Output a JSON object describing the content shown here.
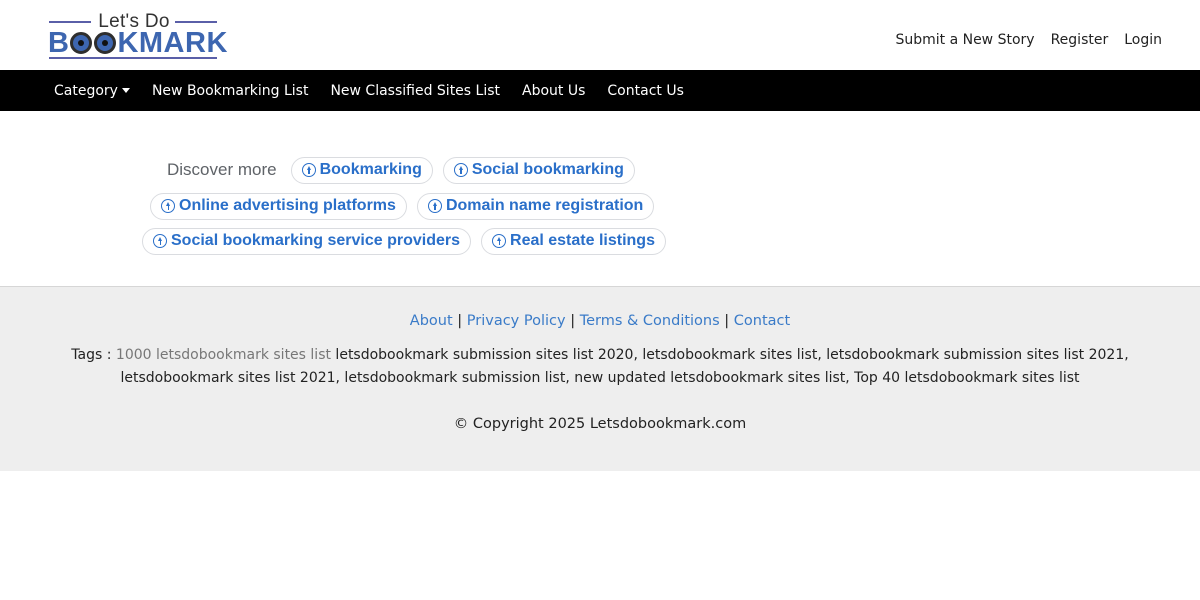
{
  "logo": {
    "top_text": "Let's Do",
    "bottom_text_pre": "B",
    "bottom_text_post": "KMARK"
  },
  "header": {
    "links": [
      "Submit a New Story",
      "Register",
      "Login"
    ]
  },
  "navbar": {
    "category": "Category",
    "items": [
      "New Bookmarking List",
      "New Classified Sites List",
      "About Us",
      "Contact Us"
    ]
  },
  "discover": {
    "label": "Discover more",
    "chips": [
      "Bookmarking",
      "Social bookmarking",
      "Online advertising platforms",
      "Domain name registration",
      "Social bookmarking service providers",
      "Real estate listings"
    ]
  },
  "footer": {
    "links": [
      "About",
      "Privacy Policy",
      "Terms & Conditions",
      "Contact"
    ],
    "separator": "|",
    "tags_prefix": "Tags : ",
    "tags_first": "1000 letsdobookmark sites list",
    "tags_rest": " letsdobookmark submission sites list 2020, letsdobookmark sites list, letsdobookmark submission sites list 2021, letsdobookmark sites list 2021, letsdobookmark submission list, new updated letsdobookmark sites list, Top 40 letsdobookmark sites list",
    "copyright": "© Copyright 2025 Letsdobookmark.com"
  },
  "colors": {
    "navbar_bg": "#000000",
    "link_blue": "#3a7bc8",
    "chip_blue": "#2a6fc9",
    "footer_bg": "#eeeeee"
  }
}
